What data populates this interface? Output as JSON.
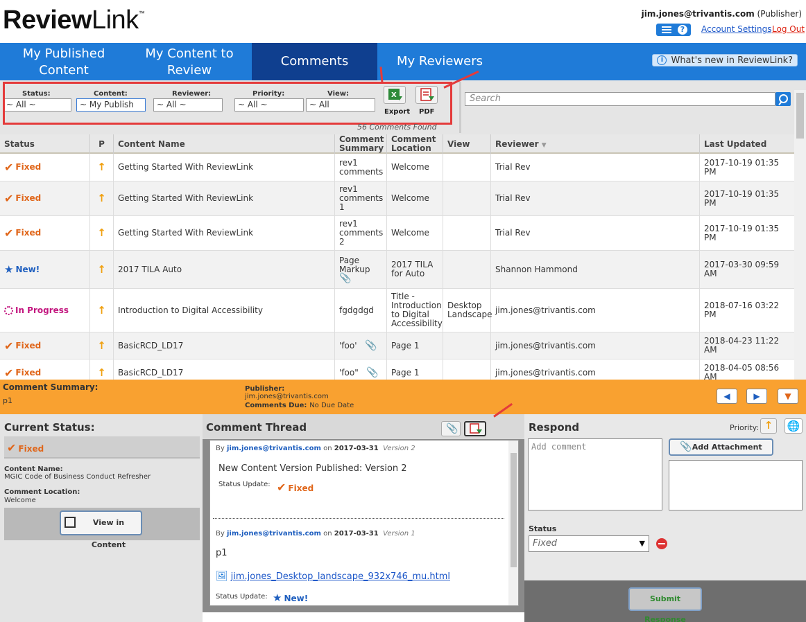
{
  "header": {
    "logo_bold": "Review",
    "logo_light": "Link",
    "logo_tm": "™",
    "user_email": "jim.jones@trivantis.com",
    "user_role": "(Publisher)",
    "account_settings": "Account Settings",
    "logout": "Log Out"
  },
  "nav": {
    "tabs": [
      {
        "label": "My Published Content",
        "active": false
      },
      {
        "label": "My Content to Review",
        "active": false
      },
      {
        "label": "Comments",
        "active": true
      },
      {
        "label": "My Reviewers",
        "active": false
      }
    ],
    "whats_new": "What's new in ReviewLink?",
    "info_icon": "i"
  },
  "filters": {
    "status_label": "Status:",
    "status_value": "~ All ~",
    "content_label": "Content:",
    "content_value": "~ My Publish",
    "reviewer_label": "Reviewer:",
    "reviewer_value": "~ All ~",
    "priority_label": "Priority:",
    "priority_value": "~ All ~",
    "view_label": "View:",
    "view_value": "~ All",
    "export_label": "Export",
    "pdf_label": "PDF",
    "search_placeholder": "Search",
    "found": "56 Comments Found"
  },
  "table": {
    "headers": {
      "status": "Status",
      "p": "P",
      "content": "Content Name",
      "summary": "Comment Summary",
      "location": "Comment Location",
      "view": "View",
      "reviewer": "Reviewer",
      "updated": "Last Updated"
    },
    "rows": [
      {
        "status": "Fixed",
        "content": "Getting Started With ReviewLink",
        "summary": "rev1 comments",
        "location": "Welcome",
        "view": "",
        "reviewer": "Trial Rev",
        "updated": "2017-10-19 01:35 PM"
      },
      {
        "status": "Fixed",
        "content": "Getting Started With ReviewLink",
        "summary": "rev1 comments 1",
        "location": "Welcome",
        "view": "",
        "reviewer": "Trial Rev",
        "updated": "2017-10-19 01:35 PM"
      },
      {
        "status": "Fixed",
        "content": "Getting Started With ReviewLink",
        "summary": "rev1 comments 2",
        "location": "Welcome",
        "view": "",
        "reviewer": "Trial Rev",
        "updated": "2017-10-19 01:35 PM"
      },
      {
        "status": "New!",
        "content": "2017 TILA Auto",
        "summary": "Page Markup",
        "location": "2017 TILA for Auto",
        "view": "",
        "reviewer": "Shannon Hammond",
        "updated": "2017-03-30 09:59 AM"
      },
      {
        "status": "In Progress",
        "content": "Introduction to Digital Accessibility",
        "summary": "fgdgdgd",
        "location": "Title - Introduction to Digital Accessibility",
        "view": "Desktop Landscape",
        "reviewer": "jim.jones@trivantis.com",
        "updated": "2018-07-16 03:22 PM"
      },
      {
        "status": "Fixed",
        "content": "BasicRCD_LD17",
        "summary": "'foo'",
        "location": "Page 1",
        "view": "",
        "reviewer": "jim.jones@trivantis.com",
        "updated": "2018-04-23 11:22 AM"
      },
      {
        "status": "Fixed",
        "content": "BasicRCD_LD17",
        "summary": "'foo\"",
        "location": "Page 1",
        "view": "",
        "reviewer": "jim.jones@trivantis.com",
        "updated": "2018-04-05 08:56 AM"
      }
    ]
  },
  "summary_bar": {
    "title": "Comment Summary:",
    "text": "p1",
    "publisher_label": "Publisher:",
    "publisher": "jim.jones@trivantis.com",
    "due_label": "Comments Due:",
    "due": "No Due Date"
  },
  "current": {
    "title": "Current Status:",
    "status": "Fixed",
    "content_label": "Content Name:",
    "content": "MGIC Code of Business Conduct Refresher",
    "location_label": "Comment Location:",
    "location": "Welcome",
    "view_btn": "View in Content"
  },
  "thread": {
    "title": "Comment Thread",
    "entries": [
      {
        "by": "By",
        "author": "jim.jones@trivantis.com",
        "on": "on",
        "date": "2017-03-31",
        "version": "Version 2",
        "body": "New Content Version Published: Version 2",
        "status_label": "Status Update:",
        "status": "Fixed"
      },
      {
        "by": "By",
        "author": "jim.jones@trivantis.com",
        "on": "on",
        "date": "2017-03-31",
        "version": "Version 1",
        "body": "p1",
        "link": "jim.jones_Desktop_landscape_932x746_mu.html",
        "status_label": "Status Update:",
        "status": "New!"
      }
    ]
  },
  "respond": {
    "title": "Respond",
    "priority_label": "Priority:",
    "comment_placeholder": "Add comment",
    "add_attachment": "Add Attachment",
    "status_label": "Status",
    "status_value": "Fixed",
    "submit": "Submit Response"
  }
}
